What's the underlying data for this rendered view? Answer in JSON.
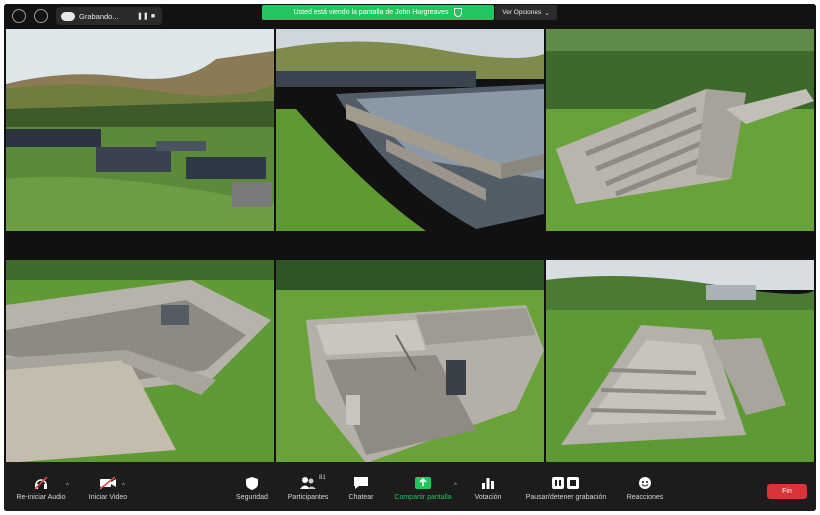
{
  "topbar": {
    "recording_label": "Grabando...",
    "share_banner": "Usted está viendo la pantalla de John Hargreaves",
    "options_label": "Ver Opciones"
  },
  "colors": {
    "share_green": "#22c55e",
    "end_red": "#d9343a",
    "toolbar_bg": "#1c1c1c",
    "window_bg": "#111111"
  },
  "tiles": [
    {
      "name": "hillside-farm-overview",
      "icon": "photo"
    },
    {
      "name": "water-filled-tank",
      "icon": "photo"
    },
    {
      "name": "stepped-empty-tank",
      "icon": "photo"
    },
    {
      "name": "empty-concrete-basin",
      "icon": "photo"
    },
    {
      "name": "channels-with-gates",
      "icon": "photo"
    },
    {
      "name": "long-raceway-tank",
      "icon": "photo"
    }
  ],
  "toolbar": {
    "audio": "Re-iniciar Audio",
    "video": "Iniciar Video",
    "security": "Seguridad",
    "participants": "Participantes",
    "participants_count": "81",
    "chat": "Chatear",
    "share": "Compartir pantalla",
    "poll": "Votación",
    "record": "Pausar/detener grabación",
    "reactions": "Reacciones",
    "end": "Fin"
  }
}
